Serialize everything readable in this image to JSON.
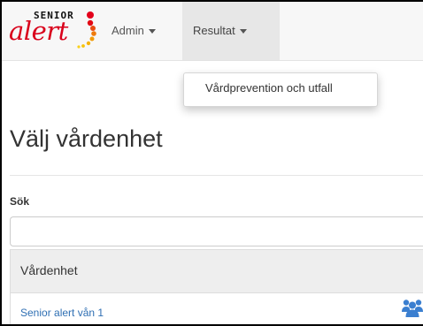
{
  "logo": {
    "top_text": "SENIOR",
    "main_text": "alert"
  },
  "navbar": {
    "items": [
      {
        "label": "Admin"
      },
      {
        "label": "Resultat"
      }
    ]
  },
  "dropdown": {
    "items": [
      {
        "label": "Vårdprevention och utfall"
      }
    ]
  },
  "page": {
    "title": "Välj vårdenhet"
  },
  "search": {
    "label": "Sök",
    "value": "",
    "placeholder": ""
  },
  "table": {
    "header": "Vårdenhet",
    "rows": [
      {
        "name": "Senior alert vån 1",
        "icon": "users-icon"
      }
    ]
  },
  "colors": {
    "brand_red": "#d9001b",
    "link_blue": "#2f6fb3",
    "icon_blue": "#3b7fd0",
    "navbar_bg": "#f7f7f7",
    "nav_active_bg": "#e7e7e7"
  }
}
